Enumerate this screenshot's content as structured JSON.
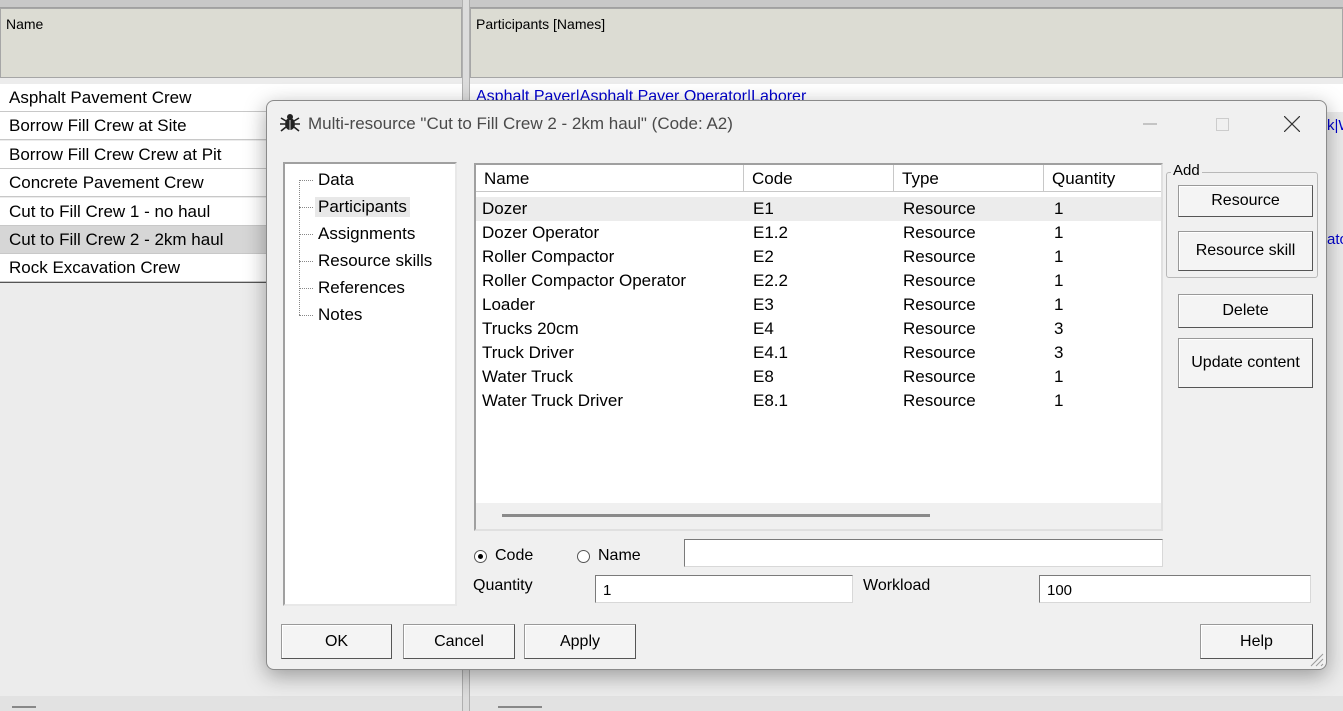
{
  "background": {
    "left_header": "Name",
    "right_header": "Participants [Names]",
    "rows": [
      {
        "label": "Asphalt Pavement Crew",
        "selected": false
      },
      {
        "label": "Borrow Fill Crew at Site",
        "selected": false
      },
      {
        "label": "Borrow Fill Crew Crew at Pit",
        "selected": false
      },
      {
        "label": "Concrete Pavement Crew",
        "selected": false
      },
      {
        "label": "Cut to Fill Crew 1 - no haul",
        "selected": false
      },
      {
        "label": "Cut to Fill Crew 2 -  2km haul",
        "selected": true
      },
      {
        "label": "Rock Excavation Crew",
        "selected": false
      }
    ],
    "first_participants": "Asphalt Paver|Asphalt Paver Operator|Laborer",
    "frag_row2": "k|W",
    "frag_row6": "ato"
  },
  "dialog": {
    "title": "Multi-resource \"Cut to Fill Crew 2 -  2km haul\" (Code: A2)",
    "nav": [
      {
        "label": "Data",
        "selected": false
      },
      {
        "label": "Participants",
        "selected": true
      },
      {
        "label": "Assignments",
        "selected": false
      },
      {
        "label": "Resource skills",
        "selected": false
      },
      {
        "label": "References",
        "selected": false
      },
      {
        "label": "Notes",
        "selected": false
      }
    ],
    "grid": {
      "columns": [
        "Name",
        "Code",
        "Type",
        "Quantity"
      ],
      "rows": [
        {
          "name": "Dozer",
          "code": "E1",
          "type": "Resource",
          "quantity": "1"
        },
        {
          "name": "Dozer Operator",
          "code": "E1.2",
          "type": "Resource",
          "quantity": "1"
        },
        {
          "name": "Roller Compactor",
          "code": "E2",
          "type": "Resource",
          "quantity": "1"
        },
        {
          "name": "Roller Compactor Operator",
          "code": "E2.2",
          "type": "Resource",
          "quantity": "1"
        },
        {
          "name": "Loader",
          "code": "E3",
          "type": "Resource",
          "quantity": "1"
        },
        {
          "name": "Trucks 20cm",
          "code": "E4",
          "type": "Resource",
          "quantity": "3"
        },
        {
          "name": "Truck Driver",
          "code": "E4.1",
          "type": "Resource",
          "quantity": "3"
        },
        {
          "name": "Water Truck",
          "code": "E8",
          "type": "Resource",
          "quantity": "1"
        },
        {
          "name": "Water Truck Driver",
          "code": "E8.1",
          "type": "Resource",
          "quantity": "1"
        }
      ],
      "selected_index": 0
    },
    "add_group_label": "Add",
    "buttons": {
      "resource": "Resource",
      "resource_skill": "Resource skill",
      "delete": "Delete",
      "update_content": "Update content",
      "ok": "OK",
      "cancel": "Cancel",
      "apply": "Apply",
      "help": "Help"
    },
    "search_mode": {
      "code_label": "Code",
      "name_label": "Name",
      "selected": "Code",
      "search_value": ""
    },
    "quantity_label": "Quantity",
    "quantity_value": "1",
    "workload_label": "Workload",
    "workload_value": "100"
  }
}
